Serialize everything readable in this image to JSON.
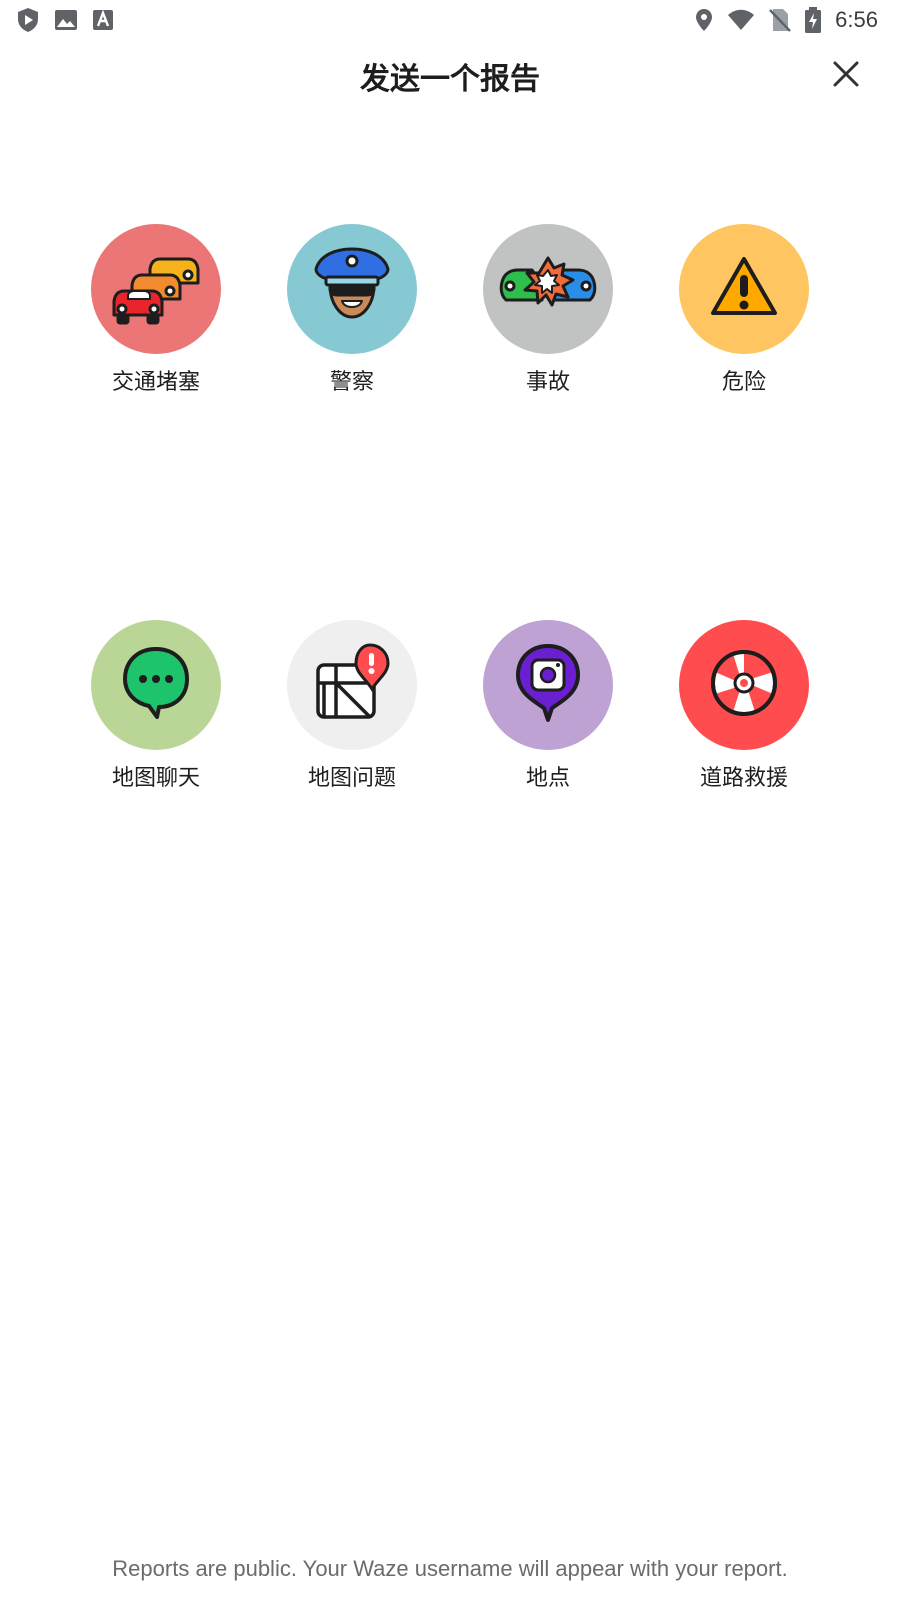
{
  "status_bar": {
    "time": "6:56",
    "left_icons": [
      "shield-play-icon",
      "image-icon",
      "font-a-icon"
    ],
    "right_icons": [
      "location-icon",
      "wifi-icon",
      "no-sim-icon",
      "battery-charging-icon"
    ]
  },
  "header": {
    "title": "发送一个报告",
    "close_icon": "close-icon"
  },
  "reports": [
    {
      "id": "traffic",
      "label": "交通堵塞",
      "color": "#EC7676",
      "icon": "traffic-cars-icon"
    },
    {
      "id": "police",
      "label": "警察",
      "color": "#87C9D3",
      "icon": "police-icon"
    },
    {
      "id": "crash",
      "label": "事故",
      "color": "#C1C2C2",
      "icon": "crash-icon"
    },
    {
      "id": "hazard",
      "label": "危险",
      "color": "#FFC561",
      "icon": "hazard-warning-icon"
    },
    {
      "id": "map-chat",
      "label": "地图聊天",
      "color": "#BAD696",
      "icon": "chat-bubble-icon"
    },
    {
      "id": "map-issue",
      "label": "地图问题",
      "color": "#EFEFEF",
      "icon": "map-issue-icon"
    },
    {
      "id": "place",
      "label": "地点",
      "color": "#BEA2D3",
      "icon": "place-camera-pin-icon"
    },
    {
      "id": "roadside",
      "label": "道路救援",
      "color": "#FF4D4F",
      "icon": "lifebuoy-icon"
    }
  ],
  "footer": {
    "text": "Reports are public. Your Waze username will appear with your report."
  }
}
